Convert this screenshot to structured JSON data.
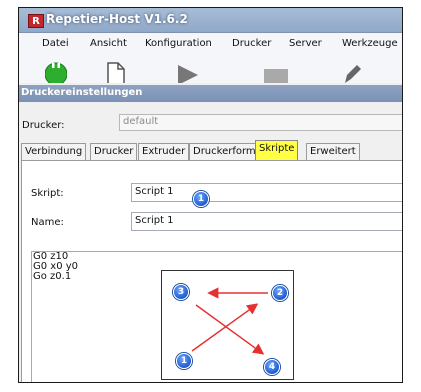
{
  "app": {
    "logo_letter": "R",
    "title": "Repetier-Host V1.6.2"
  },
  "menu": {
    "items": [
      "Datei",
      "Ansicht",
      "Konfiguration",
      "Drucker",
      "Server",
      "Werkzeuge"
    ]
  },
  "toolbar": {
    "icons": [
      "connect-icon",
      "document-icon",
      "play-icon",
      "stop-icon",
      "pen-icon"
    ]
  },
  "dialog": {
    "title": "Druckereinstellungen",
    "printer_label": "Drucker:",
    "printer_value": "default"
  },
  "tabs": [
    "Verbindung",
    "Drucker",
    "Extruder",
    "Druckerform",
    "Skripte",
    "Erweitert"
  ],
  "active_tab": "Skripte",
  "form": {
    "script_label": "Skript:",
    "script_value": "Script 1",
    "name_label": "Name:",
    "name_value": "Script 1"
  },
  "script_lines": [
    "G0 z10",
    "G0 x0 y0",
    "Go z0.1"
  ],
  "badges": {
    "one": "1",
    "two": "2",
    "three": "3",
    "four": "4"
  },
  "colors": {
    "active_tab": "#ffff44",
    "badge": "#1f5bd0",
    "arrow": "#e53030"
  }
}
